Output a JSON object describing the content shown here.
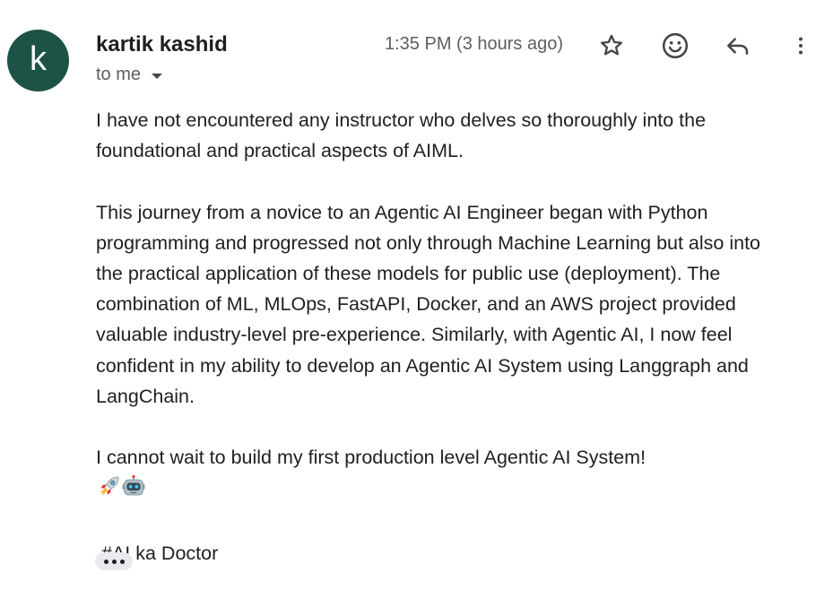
{
  "sender": {
    "avatar_letter": "k",
    "avatar_color": "#1d5346",
    "name": "kartik kashid"
  },
  "recipient": {
    "label": "to me"
  },
  "meta": {
    "timestamp": "1:35 PM (3 hours ago)"
  },
  "actions": {
    "star_icon": "star-outline-icon",
    "emoji_icon": "emoji-reaction-icon",
    "reply_icon": "reply-icon",
    "more_icon": "more-vert-icon"
  },
  "body": {
    "paragraphs": [
      "I have not encountered any instructor who delves so thoroughly into the\nfoundational and practical aspects of AIML.",
      "This journey from a novice to an Agentic AI Engineer began with Python\nprogramming and progressed not only through Machine Learning but also into\nthe practical application of these models for public use (deployment). The\ncombination of ML, MLOps, FastAPI, Docker, and an AWS project provided\nvaluable industry-level pre-experience. Similarly, with Agentic AI, I now feel\nconfident in my ability to develop an Agentic AI System using Langgraph and\nLangChain.",
      "I cannot wait to build my first production level Agentic AI System!"
    ],
    "emojis": [
      "rocket-emoji",
      "robot-emoji"
    ],
    "hashtag": "#AI ka Doctor"
  },
  "footer": {
    "show_trimmed_icon": "ellipsis-icon"
  }
}
